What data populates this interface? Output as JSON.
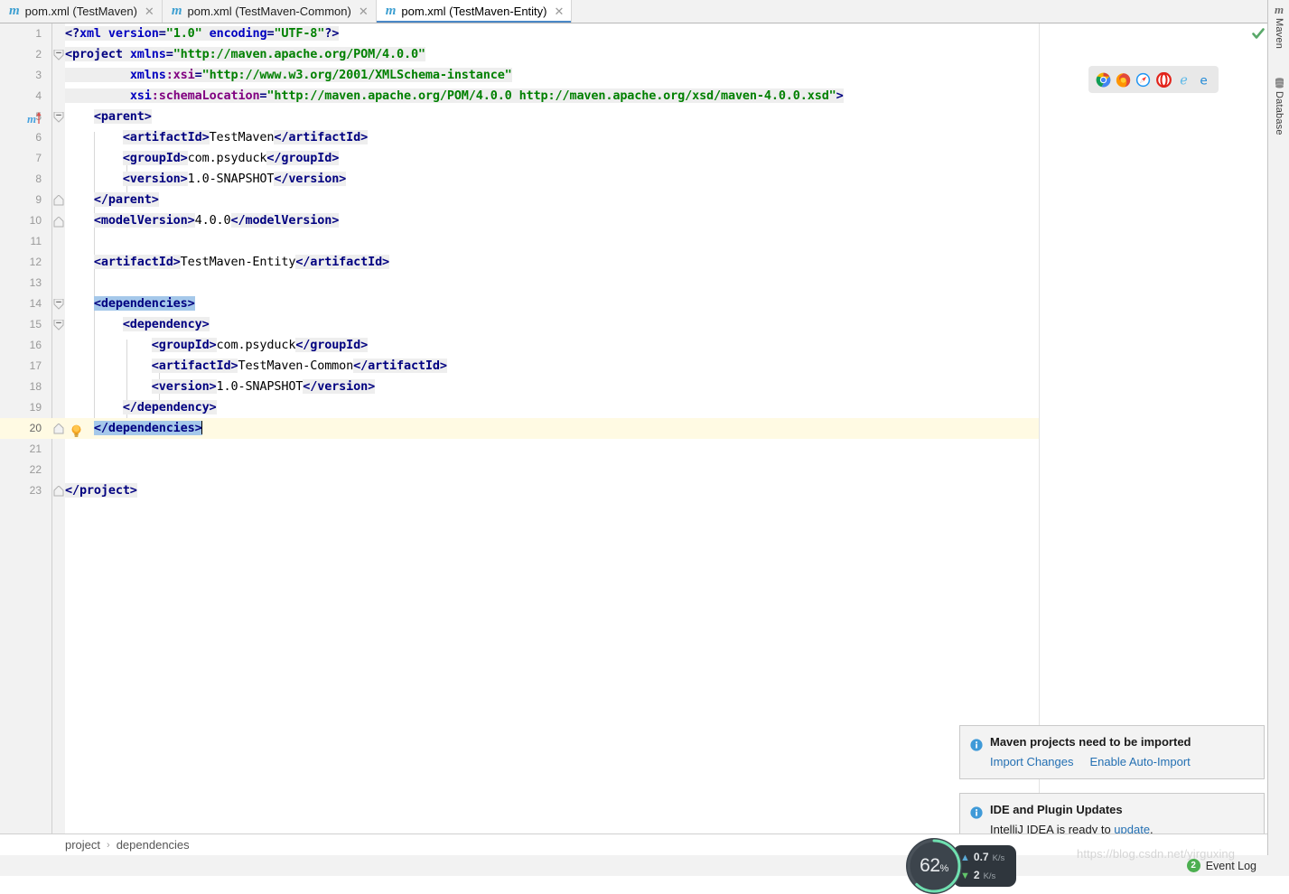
{
  "tabs": [
    {
      "label": "pom.xml (TestMaven)",
      "icon": "maven-m-icon",
      "active": false
    },
    {
      "label": "pom.xml (TestMaven-Common)",
      "icon": "maven-m-icon",
      "active": false
    },
    {
      "label": "pom.xml (TestMaven-Entity)",
      "icon": "maven-m-icon",
      "active": true
    }
  ],
  "tab_close_glyph": "✕",
  "right_tool_window": {
    "maven": {
      "label": "Maven",
      "icon": "maven-m-icon"
    },
    "database": {
      "label": "Database",
      "icon": "database-icon"
    }
  },
  "editor": {
    "inspection_status": "ok-checkmark",
    "browsers": [
      {
        "name": "chrome-icon"
      },
      {
        "name": "firefox-icon"
      },
      {
        "name": "safari-icon"
      },
      {
        "name": "opera-icon"
      },
      {
        "name": "internet-explorer-icon"
      },
      {
        "name": "edge-icon"
      }
    ],
    "lines": [
      {
        "n": "1",
        "fold": false
      },
      {
        "n": "2",
        "fold": true
      },
      {
        "n": "3",
        "fold": false
      },
      {
        "n": "4",
        "fold": false
      },
      {
        "n": "5",
        "fold": true,
        "maven_mark": true
      },
      {
        "n": "6",
        "fold": false
      },
      {
        "n": "7",
        "fold": false
      },
      {
        "n": "8",
        "fold": false
      },
      {
        "n": "9",
        "fold": false
      },
      {
        "n": "10",
        "fold": true
      },
      {
        "n": "11",
        "fold": false
      },
      {
        "n": "12",
        "fold": true
      },
      {
        "n": "13",
        "fold": false
      },
      {
        "n": "14",
        "fold": true
      },
      {
        "n": "15",
        "fold": true
      },
      {
        "n": "16",
        "fold": false
      },
      {
        "n": "17",
        "fold": false
      },
      {
        "n": "18",
        "fold": false
      },
      {
        "n": "19",
        "fold": false
      },
      {
        "n": "20",
        "fold": true,
        "bulb": true,
        "current": true
      },
      {
        "n": "21",
        "fold": false
      },
      {
        "n": "22",
        "fold": false
      },
      {
        "n": "23",
        "fold": true
      }
    ],
    "code_text": {
      "l1": "<?xml version=\"1.0\" encoding=\"UTF-8\"?>",
      "l2": "<project xmlns=\"http://maven.apache.org/POM/4.0.0\"",
      "l3": "         xmlns:xsi=\"http://www.w3.org/2001/XMLSchema-instance\"",
      "l4": "         xsi:schemaLocation=\"http://maven.apache.org/POM/4.0.0 http://maven.apache.org/xsd/maven-4.0.0.xsd\">",
      "l5": "    <parent>",
      "l6": "        <artifactId>TestMaven</artifactId>",
      "l7": "        <groupId>com.psyduck</groupId>",
      "l8": "        <version>1.0-SNAPSHOT</version>",
      "l9": "    </parent>",
      "l10": "    <modelVersion>4.0.0</modelVersion>",
      "l11": "",
      "l12": "    <artifactId>TestMaven-Entity</artifactId>",
      "l13": "",
      "l14": "    <dependencies>",
      "l15": "        <dependency>",
      "l16": "            <groupId>com.psyduck</groupId>",
      "l17": "            <artifactId>TestMaven-Common</artifactId>",
      "l18": "            <version>1.0-SNAPSHOT</version>",
      "l19": "        </dependency>",
      "l20": "    </dependencies>",
      "l21": "",
      "l22": "",
      "l23": "</project>"
    },
    "tokens": {
      "xml_decl_open": "<?",
      "xml_decl_name": "xml",
      "xml_decl_close": "?>",
      "attr_version": "version",
      "val_version": "\"1.0\"",
      "attr_encoding": "encoding",
      "val_encoding": "\"UTF-8\"",
      "tag_project_open": "<project",
      "attr_xmlns": "xmlns",
      "val_xmlns": "\"http://maven.apache.org/POM/4.0.0\"",
      "attr_xmlns_xsi_ns": "xmlns",
      "attr_xmlns_xsi_local": ":xsi",
      "val_xmlns_xsi": "\"http://www.w3.org/2001/XMLSchema-instance\"",
      "attr_schemaloc_ns": "xsi",
      "attr_schemaloc_local": ":schemaLocation",
      "val_schemaloc": "\"http://maven.apache.org/POM/4.0.0 http://maven.apache.org/xsd/maven-4.0.0.xsd\"",
      "gt": ">",
      "tag_parent_open": "<parent>",
      "tag_parent_close": "</parent>",
      "tag_artifactId_open": "<artifactId>",
      "tag_artifactId_close": "</artifactId>",
      "val_artifactId_parent": "TestMaven",
      "tag_groupId_open": "<groupId>",
      "tag_groupId_close": "</groupId>",
      "val_groupId": "com.psyduck",
      "tag_version_open": "<version>",
      "tag_version_close": "</version>",
      "val_version_snapshot": "1.0-SNAPSHOT",
      "tag_modelVersion_open": "<modelVersion>",
      "tag_modelVersion_close": "</modelVersion>",
      "val_modelVersion": "4.0.0",
      "val_artifactId_entity": "TestMaven-Entity",
      "tag_dependencies_open": "<dependencies>",
      "tag_dependencies_close": "</dependencies>",
      "tag_dependency_open": "<dependency>",
      "tag_dependency_close": "</dependency>",
      "val_artifactId_common": "TestMaven-Common",
      "tag_project_close": "</project>"
    }
  },
  "breadcrumb": {
    "items": [
      "project",
      "dependencies"
    ],
    "separator": "›"
  },
  "notifications": [
    {
      "title": "Maven projects need to be imported",
      "links": [
        "Import Changes",
        "Enable Auto-Import"
      ],
      "icon": "info-icon"
    },
    {
      "title": "IDE and Plugin Updates",
      "body_prefix": "IntelliJ IDEA is ready to ",
      "body_link": "update",
      "body_suffix": ".",
      "icon": "info-icon"
    }
  ],
  "net_widget": {
    "percent": "62",
    "percent_unit": "%",
    "upload_value": "0.7",
    "upload_unit": "K/s",
    "download_value": "2",
    "download_unit": "K/s",
    "up_arrow": "▲",
    "down_arrow": "▼"
  },
  "status_bar": {
    "event_log_label": "Event Log",
    "event_log_count": "2"
  },
  "watermark": "https://blog.csdn.net/yjrguxing",
  "colors": {
    "tab_active_underline": "#4a88c7",
    "xml_tag": "#000080",
    "xml_attr_value": "#008000",
    "xml_attr_name": "#0000c0",
    "xml_ns_prefix": "#800080",
    "brace_match_bg": "#a5c8ea",
    "current_line_bg": "#fffae3",
    "link": "#2470b3",
    "badge_green": "#4caf50"
  }
}
